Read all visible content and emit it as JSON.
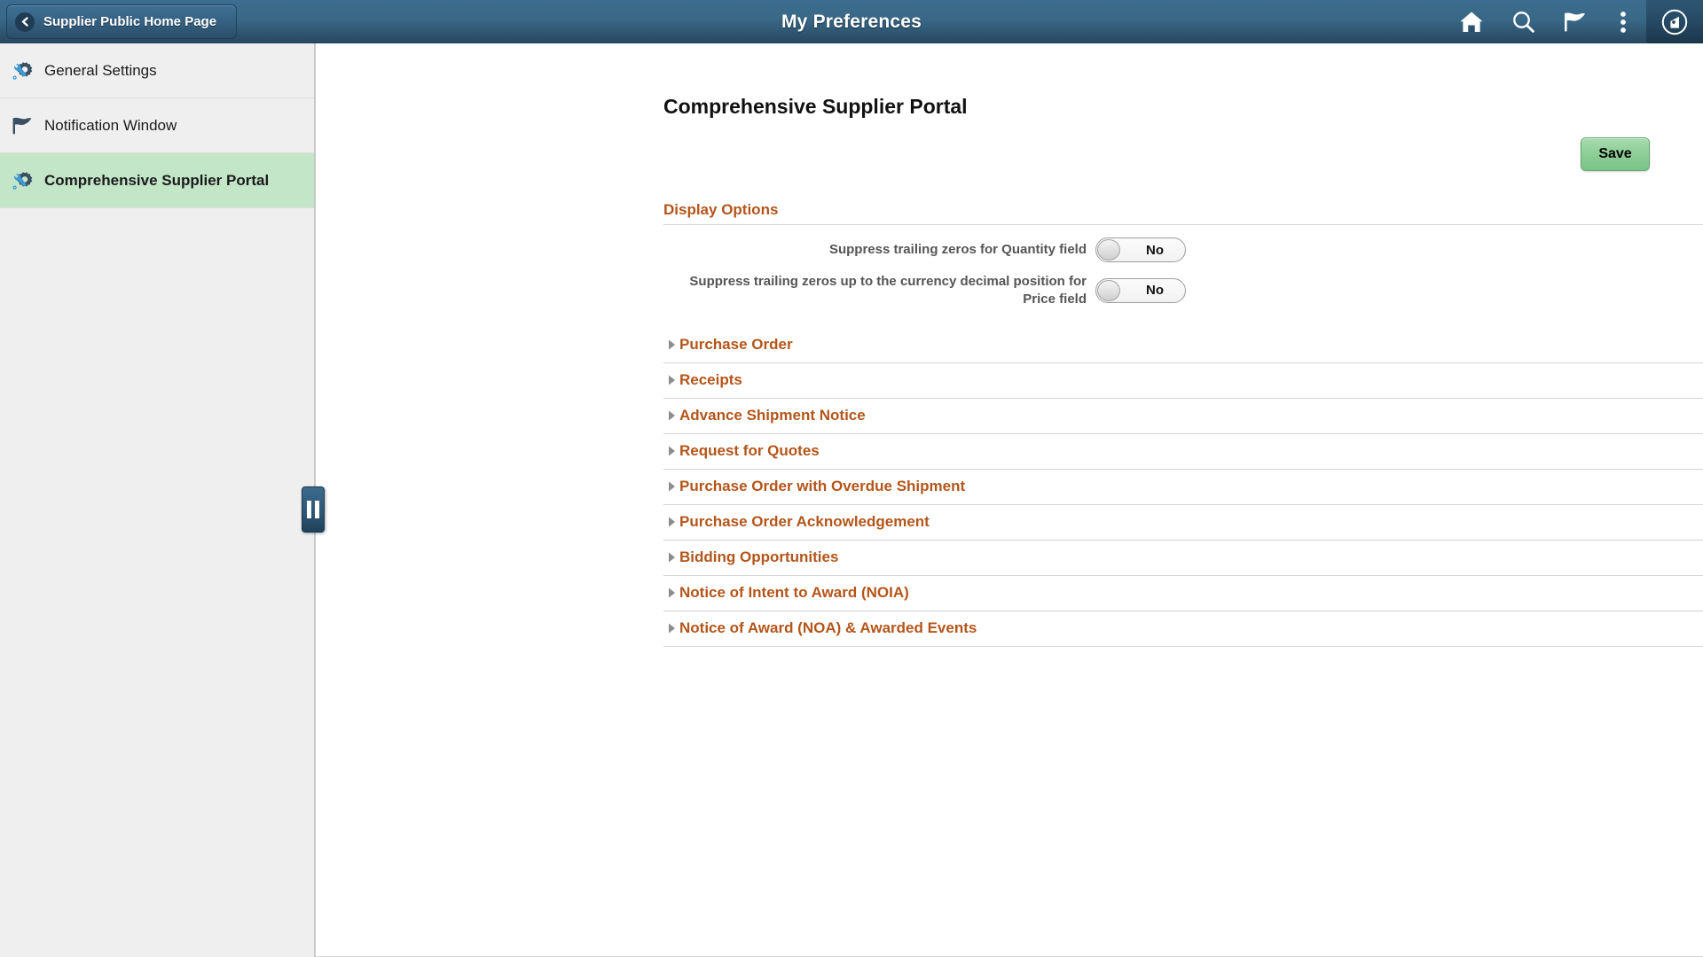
{
  "navbar": {
    "back_label": "Supplier Public Home Page",
    "title": "My Preferences",
    "icons": [
      {
        "name": "home-icon",
        "label": "Home"
      },
      {
        "name": "search-icon",
        "label": "Search"
      },
      {
        "name": "flag-icon",
        "label": "Notifications"
      },
      {
        "name": "actions-kebab-icon",
        "label": "Actions"
      },
      {
        "name": "nav-bar-icon",
        "label": "NavBar"
      }
    ]
  },
  "sidebar": {
    "items": [
      {
        "label": "General Settings",
        "icon": "wrench-gear-icon",
        "selected": false
      },
      {
        "label": "Notification Window",
        "icon": "flag-icon",
        "selected": false
      },
      {
        "label": "Comprehensive Supplier Portal",
        "icon": "wrench-gear-icon",
        "selected": true
      }
    ],
    "collapse_handle": "sidebar-collapse-handle"
  },
  "main": {
    "page_title": "Comprehensive Supplier Portal",
    "save_label": "Save",
    "display_options": {
      "heading": "Display Options",
      "rows": [
        {
          "label": "Suppress trailing zeros for Quantity field",
          "value": "No"
        },
        {
          "label": "Suppress trailing zeros up to the currency decimal position for Price field",
          "value": "No"
        }
      ]
    },
    "sections": [
      {
        "label": "Purchase Order",
        "expanded": false
      },
      {
        "label": "Receipts",
        "expanded": false
      },
      {
        "label": "Advance Shipment Notice",
        "expanded": false
      },
      {
        "label": "Request for Quotes",
        "expanded": false
      },
      {
        "label": "Purchase Order with Overdue Shipment",
        "expanded": false
      },
      {
        "label": "Purchase Order Acknowledgement",
        "expanded": false
      },
      {
        "label": "Bidding Opportunities",
        "expanded": false
      },
      {
        "label": "Notice of Intent to Award (NOIA)",
        "expanded": false
      },
      {
        "label": "Notice of Award (NOA) & Awarded Events",
        "expanded": false
      }
    ]
  },
  "colors": {
    "navbar_top": "#3d6d8e",
    "navbar_bottom": "#27475f",
    "sidebar_bg": "#efefef",
    "sidebar_selected": "#c3e6c8",
    "section_heading": "#b4551a",
    "save_button": "#8bcd95",
    "icon_blue": "#3c9bd6",
    "icon_dark": "#3a4f61"
  }
}
